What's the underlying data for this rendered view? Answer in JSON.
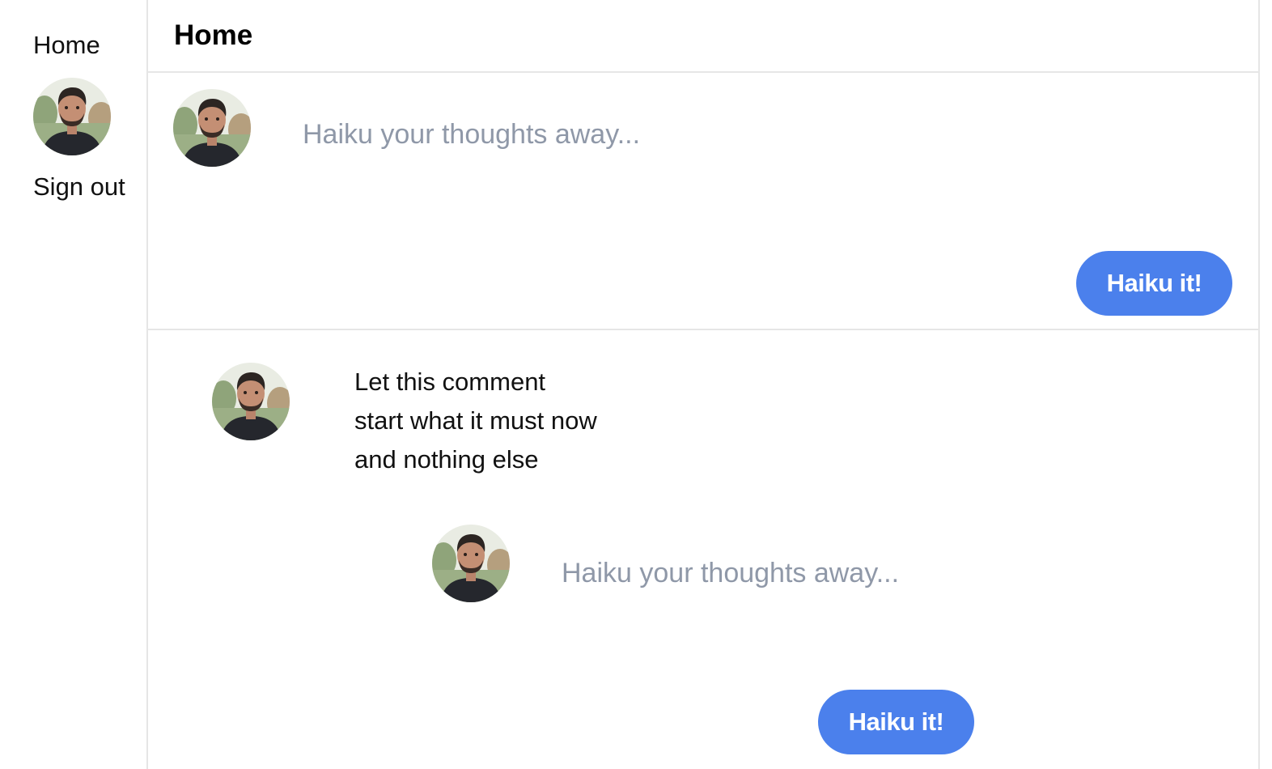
{
  "sidebar": {
    "home_label": "Home",
    "signout_label": "Sign out"
  },
  "header": {
    "title": "Home"
  },
  "composer": {
    "placeholder": "Haiku your thoughts away...",
    "submit_label": "Haiku it!"
  },
  "post": {
    "lines": [
      "Let this comment",
      "start what it must now",
      "and nothing else"
    ]
  },
  "reply": {
    "placeholder": "Haiku your thoughts away...",
    "submit_label": "Haiku it!"
  },
  "colors": {
    "accent": "#4b80ec",
    "placeholder": "#8f98a8",
    "divider": "#e6e6e6"
  },
  "icons": {
    "avatar": "user-avatar-photo"
  }
}
